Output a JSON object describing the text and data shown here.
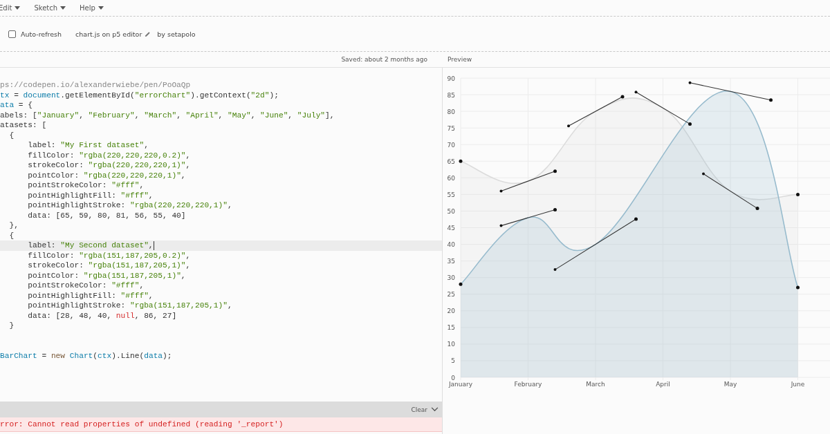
{
  "menu": [
    "Edit",
    "Sketch",
    "Help"
  ],
  "toolbar": {
    "auto_refresh": {
      "label": "Auto-refresh",
      "checked": false
    },
    "sketch_name": "chart.js on p5 editor",
    "author": "by setapolo"
  },
  "status": "Saved: about 2 months ago",
  "editor": {
    "lines": [
      {
        "kind": "code",
        "current": false,
        "tokens": [
          {
            "kind": "comment",
            "text": "ps://codepen.io/alexanderwiebe/pen/PoOaQp"
          }
        ]
      },
      {
        "kind": "code",
        "current": false,
        "tokens": [
          {
            "kind": "var",
            "text": "tx"
          },
          {
            "kind": "plain",
            "text": " = "
          },
          {
            "kind": "var",
            "text": "document"
          },
          {
            "kind": "plain",
            "text": ".getElementById("
          },
          {
            "kind": "string",
            "text": "\"errorChart\""
          },
          {
            "kind": "plain",
            "text": ").getContext("
          },
          {
            "kind": "string",
            "text": "\"2d\""
          },
          {
            "kind": "plain",
            "text": ");"
          }
        ]
      },
      {
        "kind": "code",
        "current": false,
        "tokens": [
          {
            "kind": "var",
            "text": "ata"
          },
          {
            "kind": "plain",
            "text": " = {"
          }
        ]
      },
      {
        "kind": "code",
        "current": false,
        "tokens": [
          {
            "kind": "plain",
            "text": "abels: ["
          },
          {
            "kind": "string",
            "text": "\"January\""
          },
          {
            "kind": "plain",
            "text": ", "
          },
          {
            "kind": "string",
            "text": "\"February\""
          },
          {
            "kind": "plain",
            "text": ", "
          },
          {
            "kind": "string",
            "text": "\"March\""
          },
          {
            "kind": "plain",
            "text": ", "
          },
          {
            "kind": "string",
            "text": "\"April\""
          },
          {
            "kind": "plain",
            "text": ", "
          },
          {
            "kind": "string",
            "text": "\"May\""
          },
          {
            "kind": "plain",
            "text": ", "
          },
          {
            "kind": "string",
            "text": "\"June\""
          },
          {
            "kind": "plain",
            "text": ", "
          },
          {
            "kind": "string",
            "text": "\"July\""
          },
          {
            "kind": "plain",
            "text": "],"
          }
        ]
      },
      {
        "kind": "code",
        "current": false,
        "tokens": [
          {
            "kind": "plain",
            "text": "atasets: ["
          }
        ]
      },
      {
        "kind": "code",
        "current": false,
        "tokens": [
          {
            "kind": "plain",
            "text": "  {"
          }
        ]
      },
      {
        "kind": "code",
        "current": false,
        "tokens": [
          {
            "kind": "plain",
            "text": "      label: "
          },
          {
            "kind": "string",
            "text": "\"My First dataset\""
          },
          {
            "kind": "plain",
            "text": ","
          }
        ]
      },
      {
        "kind": "code",
        "current": false,
        "tokens": [
          {
            "kind": "plain",
            "text": "      fillColor: "
          },
          {
            "kind": "string",
            "text": "\"rgba(220,220,220,0.2)\""
          },
          {
            "kind": "plain",
            "text": ","
          }
        ]
      },
      {
        "kind": "code",
        "current": false,
        "tokens": [
          {
            "kind": "plain",
            "text": "      strokeColor: "
          },
          {
            "kind": "string",
            "text": "\"rgba(220,220,220,1)\""
          },
          {
            "kind": "plain",
            "text": ","
          }
        ]
      },
      {
        "kind": "code",
        "current": false,
        "tokens": [
          {
            "kind": "plain",
            "text": "      pointColor: "
          },
          {
            "kind": "string",
            "text": "\"rgba(220,220,220,1)\""
          },
          {
            "kind": "plain",
            "text": ","
          }
        ]
      },
      {
        "kind": "code",
        "current": false,
        "tokens": [
          {
            "kind": "plain",
            "text": "      pointStrokeColor: "
          },
          {
            "kind": "string",
            "text": "\"#fff\""
          },
          {
            "kind": "plain",
            "text": ","
          }
        ]
      },
      {
        "kind": "code",
        "current": false,
        "tokens": [
          {
            "kind": "plain",
            "text": "      pointHighlightFill: "
          },
          {
            "kind": "string",
            "text": "\"#fff\""
          },
          {
            "kind": "plain",
            "text": ","
          }
        ]
      },
      {
        "kind": "code",
        "current": false,
        "tokens": [
          {
            "kind": "plain",
            "text": "      pointHighlightStroke: "
          },
          {
            "kind": "string",
            "text": "\"rgba(220,220,220,1)\""
          },
          {
            "kind": "plain",
            "text": ","
          }
        ]
      },
      {
        "kind": "code",
        "current": false,
        "tokens": [
          {
            "kind": "plain",
            "text": "      data: [65, 59, 80, 81, 56, 55, 40]"
          }
        ]
      },
      {
        "kind": "code",
        "current": false,
        "tokens": [
          {
            "kind": "plain",
            "text": "  },"
          }
        ]
      },
      {
        "kind": "code",
        "current": false,
        "tokens": [
          {
            "kind": "plain",
            "text": "  {"
          }
        ]
      },
      {
        "kind": "code",
        "current": true,
        "tokens": [
          {
            "kind": "plain",
            "text": "      label: "
          },
          {
            "kind": "string",
            "text": "\"My Second dataset\""
          },
          {
            "kind": "plain",
            "text": ","
          }
        ]
      },
      {
        "kind": "code",
        "current": false,
        "tokens": [
          {
            "kind": "plain",
            "text": "      fillColor: "
          },
          {
            "kind": "string",
            "text": "\"rgba(151,187,205,0.2)\""
          },
          {
            "kind": "plain",
            "text": ","
          }
        ]
      },
      {
        "kind": "code",
        "current": false,
        "tokens": [
          {
            "kind": "plain",
            "text": "      strokeColor: "
          },
          {
            "kind": "string",
            "text": "\"rgba(151,187,205,1)\""
          },
          {
            "kind": "plain",
            "text": ","
          }
        ]
      },
      {
        "kind": "code",
        "current": false,
        "tokens": [
          {
            "kind": "plain",
            "text": "      pointColor: "
          },
          {
            "kind": "string",
            "text": "\"rgba(151,187,205,1)\""
          },
          {
            "kind": "plain",
            "text": ","
          }
        ]
      },
      {
        "kind": "code",
        "current": false,
        "tokens": [
          {
            "kind": "plain",
            "text": "      pointStrokeColor: "
          },
          {
            "kind": "string",
            "text": "\"#fff\""
          },
          {
            "kind": "plain",
            "text": ","
          }
        ]
      },
      {
        "kind": "code",
        "current": false,
        "tokens": [
          {
            "kind": "plain",
            "text": "      pointHighlightFill: "
          },
          {
            "kind": "string",
            "text": "\"#fff\""
          },
          {
            "kind": "plain",
            "text": ","
          }
        ]
      },
      {
        "kind": "code",
        "current": false,
        "tokens": [
          {
            "kind": "plain",
            "text": "      pointHighlightStroke: "
          },
          {
            "kind": "string",
            "text": "\"rgba(151,187,205,1)\""
          },
          {
            "kind": "plain",
            "text": ","
          }
        ]
      },
      {
        "kind": "code",
        "current": false,
        "tokens": [
          {
            "kind": "plain",
            "text": "      data: [28, 48, 40, "
          },
          {
            "kind": "atom",
            "text": "null"
          },
          {
            "kind": "plain",
            "text": ", 86, 27]"
          }
        ]
      },
      {
        "kind": "code",
        "current": false,
        "tokens": [
          {
            "kind": "plain",
            "text": "  }"
          }
        ]
      },
      {
        "kind": "blank",
        "current": false
      },
      {
        "kind": "blank",
        "current": false
      },
      {
        "kind": "code",
        "current": false,
        "tokens": [
          {
            "kind": "var",
            "text": "BarChart"
          },
          {
            "kind": "plain",
            "text": " = "
          },
          {
            "kind": "keyword",
            "text": "new"
          },
          {
            "kind": "var",
            "text": " Chart"
          },
          {
            "kind": "plain",
            "text": "("
          },
          {
            "kind": "var",
            "text": "ctx"
          },
          {
            "kind": "plain",
            "text": ").Line("
          },
          {
            "kind": "var",
            "text": "data"
          },
          {
            "kind": "plain",
            "text": ");"
          }
        ]
      }
    ]
  },
  "console": {
    "clear_label": "Clear",
    "messages": [
      "rror: Cannot read properties of undefined (reading '_report')"
    ]
  },
  "preview": {
    "title": "Preview",
    "chart_data": {
      "type": "area",
      "categories": [
        "January",
        "February",
        "March",
        "April",
        "May",
        "June"
      ],
      "series": [
        {
          "color": "#dcdcdc",
          "values": [
            65,
            59,
            80,
            81,
            56,
            55
          ]
        },
        {
          "color": "#97bbcd",
          "values": [
            28,
            48,
            40,
            null,
            86,
            27
          ]
        }
      ],
      "grid": true,
      "ylim": [
        0,
        90
      ],
      "yticks": [
        0,
        5,
        10,
        15,
        20,
        25,
        30,
        35,
        40,
        45,
        50,
        55,
        60,
        65,
        70,
        75,
        80,
        85,
        90
      ]
    }
  }
}
